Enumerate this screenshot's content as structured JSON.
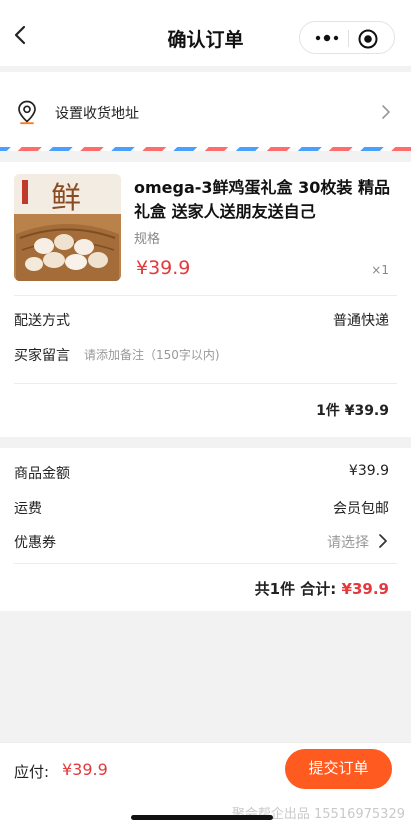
{
  "nav": {
    "title": "确认订单",
    "back_icon": "chevron-left-icon",
    "more_icon": "more-dots-icon",
    "close_icon": "target-circle-icon"
  },
  "address": {
    "label": "设置收货地址",
    "icon": "location-pin-icon"
  },
  "product": {
    "name": "omega-3鲜鸡蛋礼盒 30枚装 精品礼盒 送家人送朋友送自己",
    "image_text": "鲜",
    "spec": "规格",
    "price": "¥39.9",
    "quantity": "×1"
  },
  "delivery": {
    "label": "配送方式",
    "value": "普通快递"
  },
  "memo": {
    "label": "买家留言",
    "placeholder": "请添加备注（150字以内)"
  },
  "order_total": "1件  ¥39.9",
  "summary": {
    "goods_amount_label": "商品金额",
    "goods_amount_value": "¥39.9",
    "shipping_label": "运费",
    "shipping_value": "会员包邮",
    "coupon_label": "优惠券",
    "coupon_value": "请选择",
    "total_prefix": "共1件  合计:",
    "total_value": "¥39.9"
  },
  "footer": {
    "pay_label": "应付:",
    "pay_amount": "¥39.9",
    "submit_label": "提交订单",
    "watermark": "聚会帮企出品 15516975329"
  },
  "colors": {
    "accent_red": "#e4393c",
    "submit_orange": "#ff5a1f"
  }
}
